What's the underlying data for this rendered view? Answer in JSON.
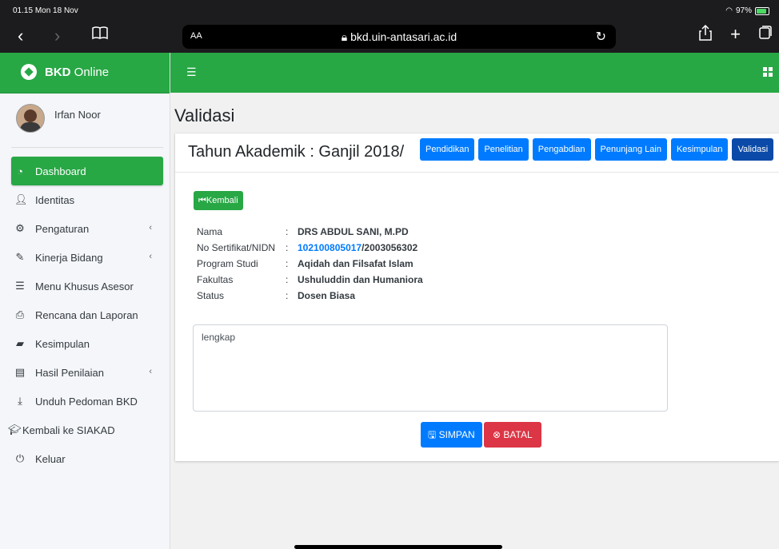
{
  "status_bar": {
    "time": "01.15",
    "date": "Mon 18 Nov",
    "battery": "97%"
  },
  "browser": {
    "text_size_label": "AA",
    "url": "bkd.uin-antasari.ac.id"
  },
  "brand": {
    "bold": "BKD",
    "rest": "Online"
  },
  "user": {
    "name": "Irfan Noor"
  },
  "sidebar": {
    "items": [
      {
        "label": "Dashboard",
        "icon": "dashboard-icon",
        "active": true
      },
      {
        "label": "Identitas",
        "icon": "user-icon"
      },
      {
        "label": "Pengaturan",
        "icon": "cog-icon",
        "chevron": "‹"
      },
      {
        "label": "Kinerja Bidang",
        "icon": "edit-icon",
        "chevron": "‹"
      },
      {
        "label": "Menu Khusus Asesor",
        "icon": "list-icon"
      },
      {
        "label": "Rencana dan Laporan",
        "icon": "print-icon"
      },
      {
        "label": "Kesimpulan",
        "icon": "book-icon"
      },
      {
        "label": "Hasil Penilaian",
        "icon": "file-icon",
        "chevron": "‹"
      },
      {
        "label": "Unduh Pedoman BKD",
        "icon": "download-icon"
      },
      {
        "label": "Kembali ke SIAKAD",
        "icon": "graduation-cap-icon"
      },
      {
        "label": "Keluar",
        "icon": "power-icon"
      }
    ]
  },
  "page": {
    "title": "Validasi"
  },
  "card": {
    "title": "Tahun Akademik : Ganjil 2018/",
    "tabs": [
      "Pendidikan",
      "Penelitian",
      "Pengabdian",
      "Penunjang Lain",
      "Kesimpulan",
      "Validasi"
    ],
    "back_label": "Kembali"
  },
  "info": {
    "nama_label": "Nama",
    "nama_sep": ":",
    "nama": "DRS ABDUL SANI, M.PD",
    "nidn_label": "No Sertifikat/NIDN",
    "nidn_sep": ":",
    "sertifikat": "102100805017",
    "nidn": "/2003056302",
    "prodi_label": "Program Studi",
    "prodi_sep": ":",
    "prodi": "Aqidah dan Filsafat Islam",
    "fakultas_label": "Fakultas",
    "fakultas_sep": ":",
    "fakultas": "Ushuluddin dan Humaniora",
    "status_label": "Status",
    "status_sep": ":",
    "status": "Dosen Biasa"
  },
  "note": {
    "value": "lengkap"
  },
  "actions": {
    "save": "SIMPAN",
    "cancel": "BATAL"
  },
  "colors": {
    "brand_green": "#28a745",
    "primary_blue": "#007bff",
    "active_tab": "#0b4aa8",
    "danger_red": "#dc3545"
  }
}
